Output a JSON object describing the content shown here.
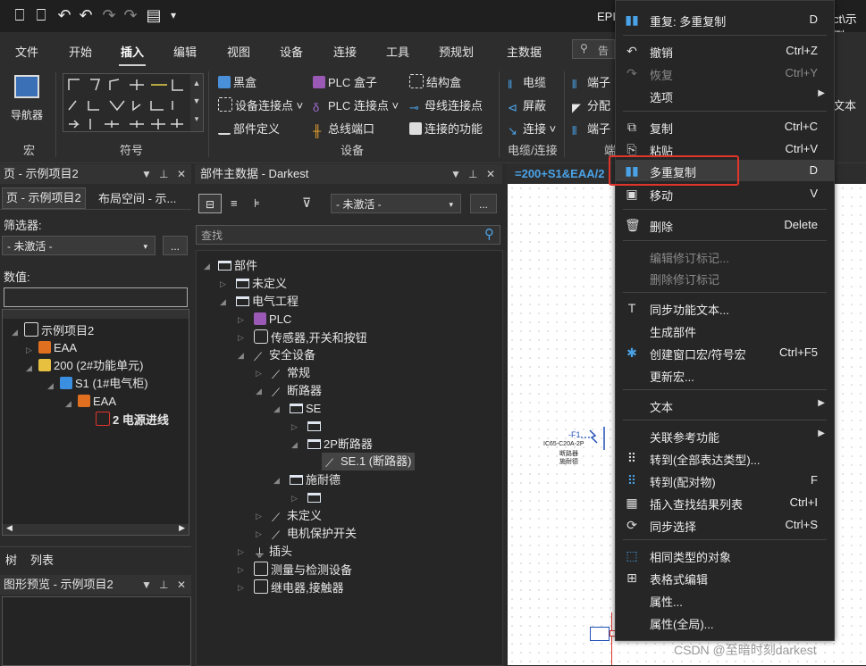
{
  "titlebar": {
    "title": "EPI",
    "right": "ct\\示例"
  },
  "ribbon_tabs": [
    "文件",
    "开始",
    "插入",
    "编辑",
    "视图",
    "设备",
    "连接",
    "工具",
    "预规划",
    "主数据"
  ],
  "ribbon": {
    "navigator": "导航器",
    "group_macro": "宏",
    "group_symbol": "符号",
    "group_device": "设备",
    "group_cable": "电缆/连接",
    "black_box": "黑盒",
    "device_conn_point": "设备连接点",
    "part_def": "部件定义",
    "plc_box": "PLC 盒子",
    "plc_conn_point": "PLC 连接点",
    "bus_port": "总线端口",
    "structure_box": "结构盒",
    "busbar_point": "母线连接点",
    "conn_function": "连接的功能",
    "cable": "电缆",
    "shield": "屏蔽",
    "connection": "连接",
    "terminal1": "端子",
    "branch": "分配",
    "terminal2": "端子",
    "search_hint": "告",
    "text_right": "文本",
    "group_right": "端"
  },
  "left_panel": {
    "header": "页 - 示例项目2",
    "tab1": "页 - 示例项目2",
    "tab2": "布局空间 - 示...",
    "filter_label": "筛选器:",
    "filter_value": "- 未激活 -",
    "value_label": "数值:",
    "tree": [
      "示例项目2",
      "EAA",
      "200 (2#功能单元)",
      "S1 (1#电气柜)",
      "EAA",
      "2 电源进线"
    ],
    "bottom_tab1": "树",
    "bottom_tab2": "列表"
  },
  "preview_panel": {
    "header": "图形预览 - 示例项目2"
  },
  "mid_panel": {
    "header": "部件主数据 - Darkest",
    "filter_value": "- 未激活 -",
    "search_placeholder": "查找",
    "tree": [
      "部件",
      "未定义",
      "电气工程",
      "PLC",
      "传感器,开关和按钮",
      "安全设备",
      "常规",
      "断路器",
      "SE",
      "",
      "2P断路器",
      "SE.1 (断路器)",
      "施耐德",
      "",
      "未定义",
      "电机保护开关",
      "插头",
      "测量与检测设备",
      "继电器,接触器"
    ]
  },
  "doc_tab": {
    "label": "=200+S1&EAA/2"
  },
  "canvas": {
    "device_tag": "-F1",
    "device_model": "IC65-C20A-2P",
    "device_name1": "断路器",
    "device_name2": "施耐德",
    "watermark": "CSDN @至暗时刻darkest"
  },
  "context_menu": {
    "items": [
      {
        "label": "重复: 多重复制",
        "shortcut": "D",
        "icon": "multi-copy-icon",
        "disabled": false
      },
      {
        "label": "撤销",
        "shortcut": "Ctrl+Z",
        "icon": "undo-icon",
        "disabled": false
      },
      {
        "label": "恢复",
        "shortcut": "Ctrl+Y",
        "icon": "redo-icon",
        "disabled": true
      },
      {
        "label": "选项",
        "shortcut": "",
        "icon": "",
        "disabled": false,
        "submenu": true
      },
      {
        "label": "复制",
        "shortcut": "Ctrl+C",
        "icon": "copy-icon",
        "disabled": false
      },
      {
        "label": "粘贴",
        "shortcut": "Ctrl+V",
        "icon": "paste-icon",
        "disabled": false
      },
      {
        "label": "多重复制",
        "shortcut": "D",
        "icon": "multi-copy-icon",
        "disabled": false,
        "highlighted": true
      },
      {
        "label": "移动",
        "shortcut": "V",
        "icon": "move-icon",
        "disabled": false
      },
      {
        "label": "删除",
        "shortcut": "Delete",
        "icon": "delete-icon",
        "disabled": false
      },
      {
        "label": "编辑修订标记...",
        "shortcut": "",
        "icon": "",
        "disabled": true
      },
      {
        "label": "删除修订标记",
        "shortcut": "",
        "icon": "",
        "disabled": true
      },
      {
        "label": "同步功能文本...",
        "shortcut": "",
        "icon": "sync-text-icon",
        "disabled": false
      },
      {
        "label": "生成部件",
        "shortcut": "",
        "icon": "",
        "disabled": false
      },
      {
        "label": "创建窗口宏/符号宏",
        "shortcut": "Ctrl+F5",
        "icon": "macro-icon",
        "disabled": false
      },
      {
        "label": "更新宏...",
        "shortcut": "",
        "icon": "",
        "disabled": false
      },
      {
        "label": "文本",
        "shortcut": "",
        "icon": "",
        "disabled": false,
        "submenu": true
      },
      {
        "label": "关联参考功能",
        "shortcut": "",
        "icon": "",
        "disabled": false,
        "submenu": true
      },
      {
        "label": "转到(全部表达类型)...",
        "shortcut": "",
        "icon": "goto-all-icon",
        "disabled": false
      },
      {
        "label": "转到(配对物)",
        "shortcut": "F",
        "icon": "goto-pair-icon",
        "disabled": false
      },
      {
        "label": "插入查找结果列表",
        "shortcut": "Ctrl+I",
        "icon": "find-list-icon",
        "disabled": false
      },
      {
        "label": "同步选择",
        "shortcut": "Ctrl+S",
        "icon": "sync-select-icon",
        "disabled": false
      },
      {
        "label": "相同类型的对象",
        "shortcut": "",
        "icon": "same-type-icon",
        "disabled": false
      },
      {
        "label": "表格式编辑",
        "shortcut": "",
        "icon": "table-edit-icon",
        "disabled": false
      },
      {
        "label": "属性...",
        "shortcut": "",
        "icon": "",
        "disabled": false
      },
      {
        "label": "属性(全局)...",
        "shortcut": "",
        "icon": "",
        "disabled": false
      }
    ]
  },
  "colors": {
    "highlight_box": "#e0352b",
    "menu_bg": "#262626",
    "accent": "#2f8fd8"
  }
}
